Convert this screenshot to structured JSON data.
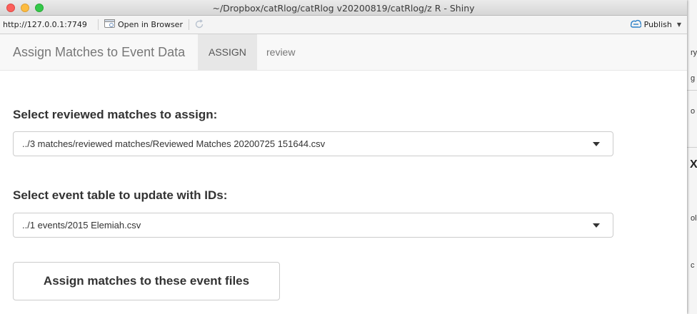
{
  "window": {
    "title": "~/Dropbox/catRlog/catRlog v20200819/catRlog/z R - Shiny"
  },
  "viewer_toolbar": {
    "url": "http://127.0.0.1:7749",
    "open_browser_label": "Open in Browser",
    "publish_label": "Publish"
  },
  "navbar": {
    "brand": "Assign Matches to Event Data",
    "tabs": [
      {
        "label": "ASSIGN",
        "active": true
      },
      {
        "label": "review",
        "active": false
      }
    ]
  },
  "form": {
    "reviewed_label": "Select reviewed matches to assign:",
    "reviewed_value": "../3 matches/reviewed matches/Reviewed Matches 20200725 151644.csv",
    "event_label": "Select event table to update with IDs:",
    "event_value": "../1 events/2015 Elemiah.csv",
    "assign_button": "Assign matches to these event files"
  },
  "background_window": {
    "glyphs": [
      "ry",
      "g",
      "o",
      "X",
      "ol",
      "c"
    ]
  },
  "colors": {
    "close": "#fc605c",
    "minimize": "#fdbc40",
    "maximize": "#34c84a",
    "publish_accent": "#2a7fc7"
  },
  "icons": {
    "open_browser": "browser-window-icon",
    "refresh": "refresh-icon",
    "publish": "publish-icon",
    "dropdown": "caret-down-icon"
  }
}
